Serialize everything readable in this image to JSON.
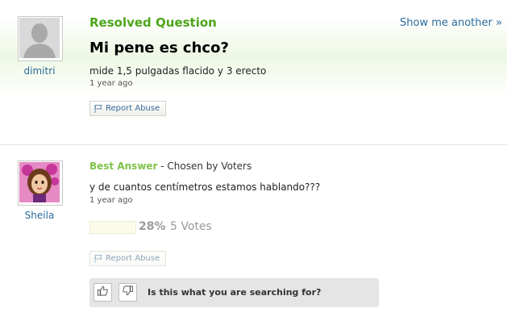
{
  "question": {
    "status_label": "Resolved Question",
    "show_another_label": "Show me another »",
    "title": "Mi pene es chco?",
    "details": "mide 1,5 pulgadas flacido y 3 erecto",
    "timestamp": "1 year ago",
    "report_abuse_label": "Report Abuse",
    "asker": {
      "name": "dimitri",
      "avatar_icon": "default-user-silhouette-icon"
    }
  },
  "best_answer": {
    "label": "Best Answer",
    "chosen_by": " - Chosen by Voters",
    "text": "y de cuantos centímetros estamos hablando???",
    "timestamp": "1 year ago",
    "votes": {
      "percent_label": "28%",
      "count_label": "5 Votes",
      "fraction": 0.28
    },
    "report_abuse_label": "Report Abuse",
    "answerer": {
      "name": "Sheila",
      "avatar_icon": "cartoon-avatar-icon"
    }
  },
  "feedback": {
    "prompt": "Is this what you are searching for?",
    "thumbs_up_icon": "thumbs-up-icon",
    "thumbs_down_icon": "thumbs-down-icon"
  },
  "colors": {
    "accent_green": "#4ca51a",
    "best_answer_green": "#7ec24b",
    "link_blue": "#2a6a9c"
  }
}
